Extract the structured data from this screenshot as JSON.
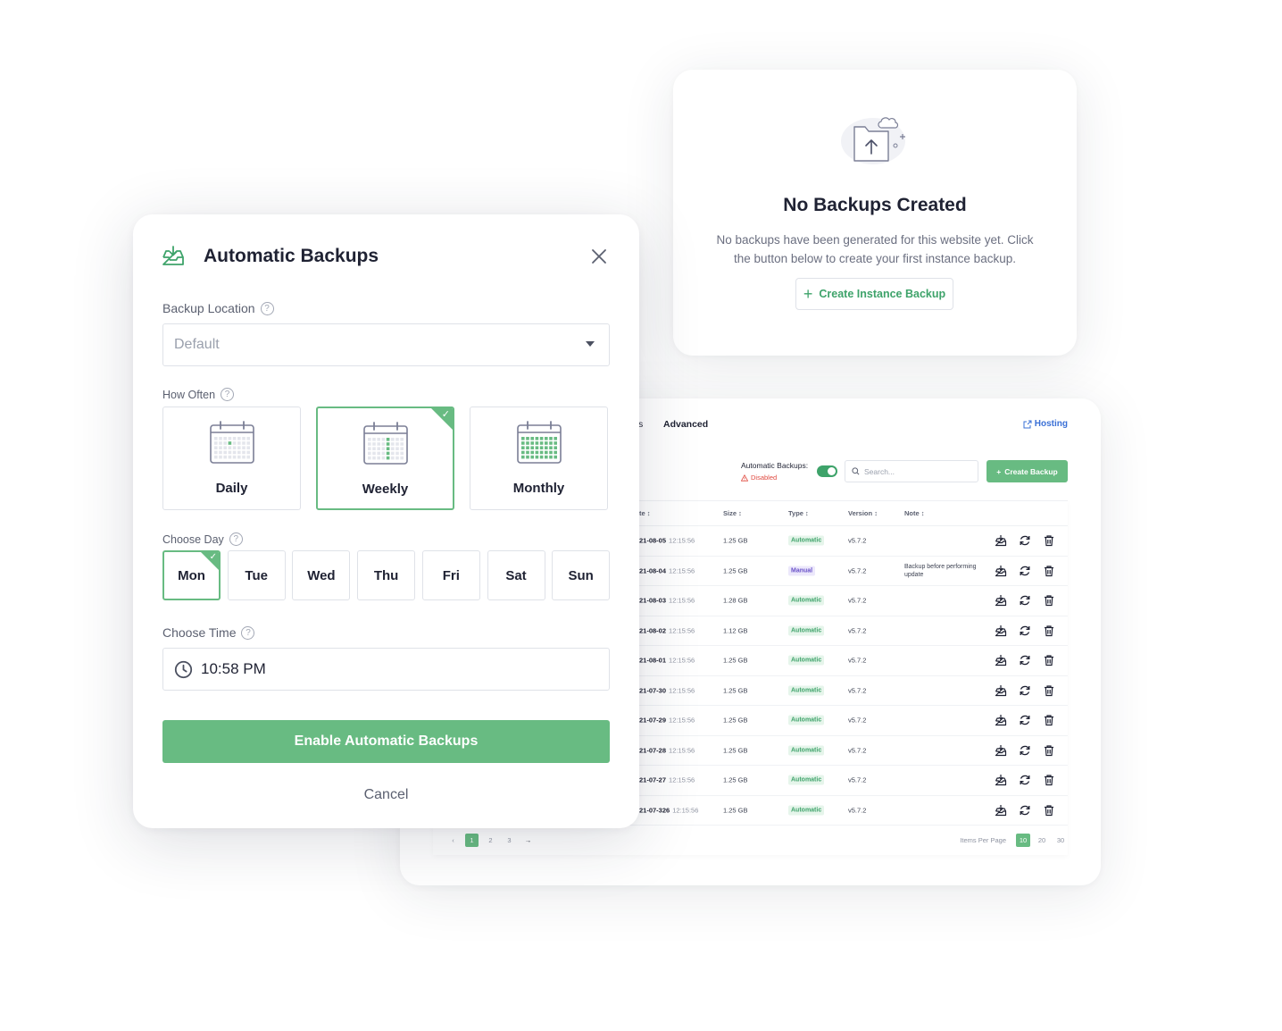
{
  "empty_state": {
    "title": "No Backups Created",
    "description": "No backups have been generated for this website yet. Click the button below to create your first instance backup.",
    "button_label": "Create Instance Backup",
    "illustration_icon": "folder-upload-icon"
  },
  "table_panel": {
    "tabs": [
      {
        "label": "s"
      },
      {
        "label": "Advanced"
      }
    ],
    "hosting_link": "Hosting",
    "automatic_backups_label": "Automatic Backups:",
    "automatic_backups_status": "Disabled",
    "automatic_backups_enabled": true,
    "search_placeholder": "Search...",
    "create_backup_label": "Create Backup",
    "columns": [
      "te",
      "Size",
      "Type",
      "Version",
      "Note"
    ],
    "rows": [
      {
        "date": "21-08-05",
        "time": "12:15:56",
        "size": "1.25 GB",
        "type": "Automatic",
        "version": "v5.7.2",
        "note": ""
      },
      {
        "date": "21-08-04",
        "time": "12:15:56",
        "size": "1.25 GB",
        "type": "Manual",
        "version": "v5.7.2",
        "note": "Backup before performing update"
      },
      {
        "date": "21-08-03",
        "time": "12:15:56",
        "size": "1.28 GB",
        "type": "Automatic",
        "version": "v5.7.2",
        "note": ""
      },
      {
        "date": "21-08-02",
        "time": "12:15:56",
        "size": "1.12 GB",
        "type": "Automatic",
        "version": "v5.7.2",
        "note": ""
      },
      {
        "date": "21-08-01",
        "time": "12:15:56",
        "size": "1.25 GB",
        "type": "Automatic",
        "version": "v5.7.2",
        "note": ""
      },
      {
        "date": "21-07-30",
        "time": "12:15:56",
        "size": "1.25 GB",
        "type": "Automatic",
        "version": "v5.7.2",
        "note": ""
      },
      {
        "date": "21-07-29",
        "time": "12:15:56",
        "size": "1.25 GB",
        "type": "Automatic",
        "version": "v5.7.2",
        "note": ""
      },
      {
        "date": "21-07-28",
        "time": "12:15:56",
        "size": "1.25 GB",
        "type": "Automatic",
        "version": "v5.7.2",
        "note": ""
      },
      {
        "date": "21-07-27",
        "time": "12:15:56",
        "size": "1.25 GB",
        "type": "Automatic",
        "version": "v5.7.2",
        "note": ""
      },
      {
        "date": "21-07-326",
        "time": "12:15:56",
        "size": "1.25 GB",
        "type": "Automatic",
        "version": "v5.7.2",
        "note": ""
      }
    ],
    "pagination": {
      "prev": "‹",
      "pages": [
        "1",
        "2",
        "3"
      ],
      "active_page": "1",
      "next": "→"
    },
    "items_per_page_label": "Items Per Page",
    "items_per_page_options": [
      "10",
      "20",
      "30"
    ],
    "items_per_page_selected": "10"
  },
  "modal": {
    "title": "Automatic Backups",
    "header_icon": "inbox-download-icon",
    "close_icon": "close-icon",
    "backup_location_label": "Backup Location",
    "backup_location_value": "Default",
    "how_often_label": "How Often",
    "frequencies": [
      {
        "label": "Daily",
        "selected": false
      },
      {
        "label": "Weekly",
        "selected": true
      },
      {
        "label": "Monthly",
        "selected": false
      }
    ],
    "choose_day_label": "Choose Day",
    "days": [
      {
        "label": "Mon",
        "selected": true
      },
      {
        "label": "Tue",
        "selected": false
      },
      {
        "label": "Wed",
        "selected": false
      },
      {
        "label": "Thu",
        "selected": false
      },
      {
        "label": "Fri",
        "selected": false
      },
      {
        "label": "Sat",
        "selected": false
      },
      {
        "label": "Sun",
        "selected": false
      }
    ],
    "choose_time_label": "Choose Time",
    "time_value": "10:58 PM",
    "enable_button": "Enable Automatic Backups",
    "cancel_button": "Cancel"
  },
  "colors": {
    "accent_green": "#68bb82",
    "text_green": "#3ea36a",
    "link_blue": "#3a70d6",
    "danger_red": "#e0493f",
    "manual_purple": "#6a52c9"
  }
}
